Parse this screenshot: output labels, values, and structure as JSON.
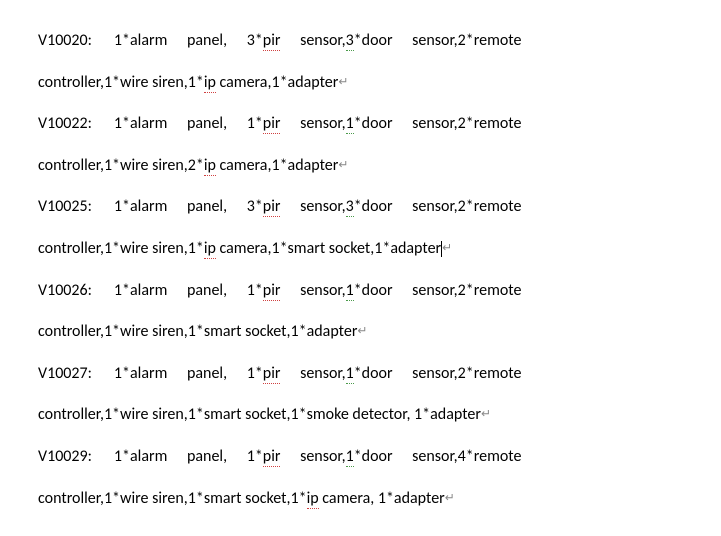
{
  "items": [
    {
      "code": "V10020",
      "parts": {
        "p1": "1*alarm",
        "p2": "panel,",
        "p3": "3*",
        "p4_under": "pir",
        "p5": "sensor,",
        "p6_under": "3",
        "p7": "*door",
        "p8": "sensor,2*remote",
        "line2a": "controller,1*wire siren,1*",
        "line2b_under": "ip",
        "line2c": " camera,1*adapter"
      }
    },
    {
      "code": "V10022",
      "parts": {
        "p1": "1*alarm",
        "p2": "panel,",
        "p3": "1*",
        "p4_under": "pir",
        "p5": "sensor,",
        "p6_under": "1",
        "p7": "*door",
        "p8": "sensor,2*remote",
        "line2a": "controller,1*wire siren,2*",
        "line2b_under": "ip",
        "line2c": " camera,1*adapter"
      }
    },
    {
      "code": "V10025",
      "parts": {
        "p1": "1*alarm",
        "p2": "panel,",
        "p3": "3*",
        "p4_under": "pir",
        "p5": "sensor,",
        "p6_under": "3",
        "p7": "*door",
        "p8": "sensor,2*remote",
        "line2a": "controller,1*wire siren,1*",
        "line2b_under": "ip",
        "line2c": " camera,1*smart socket,1*adapter"
      },
      "cursor": true
    },
    {
      "code": "V10026",
      "parts": {
        "p1": "1*alarm",
        "p2": "panel,",
        "p3": "1*",
        "p4_under": "pir",
        "p5": "sensor,",
        "p6_under": "1",
        "p7": "*door",
        "p8": "sensor,2*remote",
        "line2a": "controller,1*wire siren,1*smart socket,1*adapter",
        "line2b_under": "",
        "line2c": ""
      }
    },
    {
      "code": "V10027",
      "parts": {
        "p1": "1*alarm",
        "p2": "panel,",
        "p3": "1*",
        "p4_under": "pir",
        "p5": "sensor,",
        "p6_under": "1",
        "p7": "*door",
        "p8": "sensor,2*remote",
        "line2a": "controller,1*wire siren,1*smart socket,1*smoke detector, 1*adapter",
        "line2b_under": "",
        "line2c": ""
      }
    },
    {
      "code": "V10029",
      "parts": {
        "p1": "1*alarm",
        "p2": "panel,",
        "p3": "1*",
        "p4_under": "pir",
        "p5": "sensor,",
        "p6_under": "1",
        "p7": "*door",
        "p8": "sensor,4*remote",
        "line2a": "controller,1*wire siren,1*smart socket,1*",
        "line2b_under": "ip",
        "line2c": " camera, 1*adapter"
      }
    }
  ],
  "return_glyph": "↵"
}
